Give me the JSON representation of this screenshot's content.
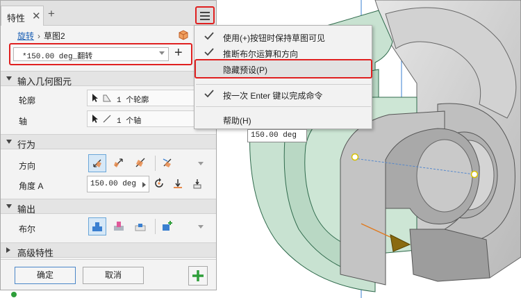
{
  "tab": {
    "label": "特性",
    "close": "✕",
    "add": "+"
  },
  "breadcrumb": {
    "feature": "旋转",
    "separator": "›",
    "sketch": "草图2"
  },
  "preset": {
    "value": "*150.00 deg_翻转",
    "add": "+"
  },
  "sections": {
    "input_geometry": "输入几何图元",
    "behavior": "行为",
    "output": "输出",
    "advanced": "高级特性"
  },
  "input_geometry": {
    "profile_label": "轮廓",
    "profile_value": "1 个轮廓",
    "axis_label": "轴",
    "axis_value": "1 个轴"
  },
  "behavior": {
    "direction_label": "方向",
    "angle_label": "角度 A",
    "angle_value": "150.00 deg"
  },
  "output": {
    "boolean_label": "布尔"
  },
  "buttons": {
    "ok": "确定",
    "cancel": "取消"
  },
  "menu": {
    "items": [
      {
        "label": "使用(+)按钮时保持草图可见",
        "checked": true
      },
      {
        "label": "推断布尔运算和方向",
        "checked": true
      },
      {
        "label": "隐藏预设(P)",
        "checked": false
      },
      {
        "label": "按一次 Enter 键以完成命令",
        "checked": true
      },
      {
        "label": "帮助(H)",
        "checked": false
      }
    ]
  },
  "viewport": {
    "value_tip": "150.00 deg"
  },
  "colors": {
    "accent": "#1a5fb4",
    "highlight_border": "#e02020",
    "ok_green": "#2e9e3a",
    "model_grey": "#c9c9c9",
    "preview_green": "#c6e0cf",
    "active_button_bg": "#d6e8f7",
    "icon_orange": "#e8894a"
  }
}
